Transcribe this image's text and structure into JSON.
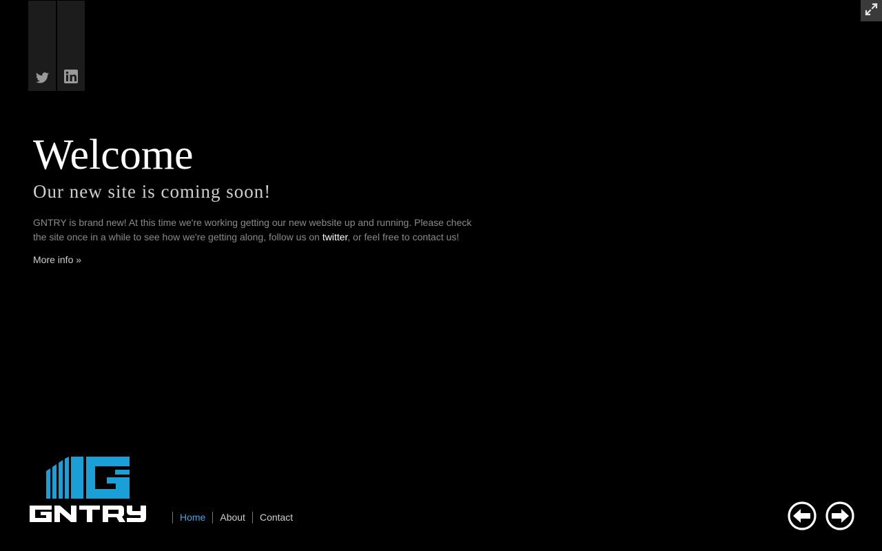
{
  "social": {
    "twitter_icon": "twitter-icon",
    "linkedin_icon": "linkedin-icon"
  },
  "fullscreen": {
    "icon": "fullscreen-toggle-icon"
  },
  "hero": {
    "title": "Welcome",
    "subtitle": "Our new site is coming soon!",
    "body_before_link": "GNTRY is brand new! At this time we're working getting our new website up and running. Please check the site once in a while to see how we're getting along, follow us on ",
    "body_link": "twitter",
    "body_after_link": ", or feel free to contact us!",
    "more_info": "More info »"
  },
  "logo": {
    "text": "GNTRY",
    "brand_color": "#1a9fd6"
  },
  "nav": {
    "items": [
      {
        "label": "Home",
        "active": true
      },
      {
        "label": "About",
        "active": false
      },
      {
        "label": "Contact",
        "active": false
      }
    ]
  },
  "slider": {
    "prev_icon": "arrow-left-circle-icon",
    "next_icon": "arrow-right-circle-icon"
  },
  "colors": {
    "background": "#000000",
    "accent": "#4aa3df",
    "social_tab": "#1c1c1c"
  }
}
